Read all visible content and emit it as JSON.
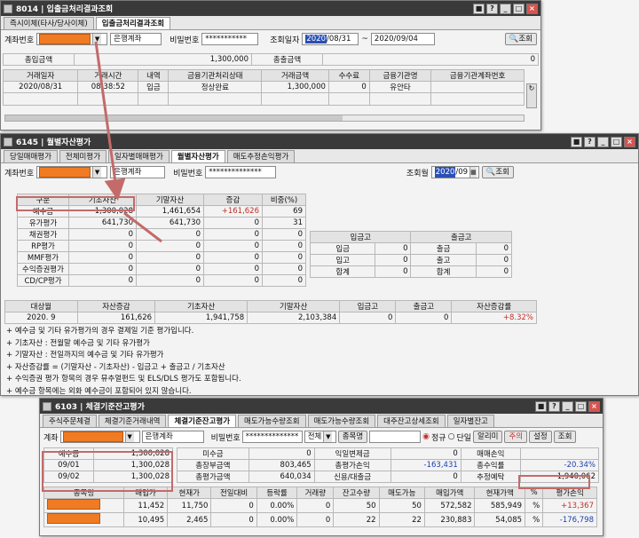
{
  "win1": {
    "title": "8014 | 입출금처리결과조회",
    "tabs": [
      "즉시이체(타사/당사이체)",
      "입출금처리결과조회"
    ],
    "account_label": "계좌번호",
    "account_name": "은행계좌",
    "password_label": "비밀번호",
    "password_value": "***********",
    "date_label": "조회일자",
    "date_from_sel": "2020",
    "date_from_rest": "/08/31",
    "date_sep": "~",
    "date_to": "2020/09/04",
    "search_label": "조회",
    "total_in_label": "총입금액",
    "total_in_value": "1,300,000",
    "total_out_label": "총출금액",
    "total_out_value": "0",
    "headers": [
      "거래일자",
      "거래시간",
      "내역",
      "금융기관처리상태",
      "거래금액",
      "수수료",
      "금융기관명",
      "금융기관계좌번호"
    ],
    "rows": [
      [
        "2020/08/31",
        "08:38:52",
        "입금",
        "정상완료",
        "1,300,000",
        "0",
        "유안타",
        ""
      ]
    ]
  },
  "win2": {
    "title": "6145 | 월별자산평가",
    "tabs": [
      "당일매매평가",
      "전체미평가",
      "일자별매매평가",
      "월별자산평가",
      "매도추정손익평가"
    ],
    "account_label": "계좌번호",
    "account_name": "은행계좌",
    "password_label": "비밀번호",
    "password_value": "**************",
    "month_label": "조회월",
    "month_sel": "2020",
    "month_rest": "/09",
    "search_label": "조회",
    "headers": [
      "구분",
      "기초자산",
      "기말자산",
      "증감",
      "비중(%)"
    ],
    "rows": [
      [
        "예수금",
        "1,300,028",
        "1,461,654",
        "+161,626",
        "69"
      ],
      [
        "유가평가",
        "641,730",
        "641,730",
        "0",
        "31"
      ],
      [
        "채권평가",
        "0",
        "0",
        "0",
        "0"
      ],
      [
        "RP평가",
        "0",
        "0",
        "0",
        "0"
      ],
      [
        "MMF평가",
        "0",
        "0",
        "0",
        "0"
      ],
      [
        "수익증권평가",
        "0",
        "0",
        "0",
        "0"
      ],
      [
        "CD/CP평가",
        "0",
        "0",
        "0",
        "0"
      ]
    ],
    "inout_headers": [
      "입금고",
      "출금고"
    ],
    "inout_rows": [
      [
        "입금",
        "0",
        "출금",
        "0"
      ],
      [
        "입고",
        "0",
        "출고",
        "0"
      ],
      [
        "합계",
        "0",
        "합계",
        "0"
      ]
    ],
    "summary_headers": [
      "대상월",
      "자산증감",
      "기초자산",
      "기말자산",
      "입금고",
      "출금고",
      "자산증감률"
    ],
    "summary_row": [
      "2020. 9",
      "161,626",
      "1,941,758",
      "2,103,384",
      "0",
      "0",
      "+8.32%"
    ],
    "notes": [
      "+ 예수금 및 기타 유가평가의 경우 결제일 기준 평가입니다.",
      "+ 기초자산 : 전월말 예수금 및 기타 유가평가",
      "+ 기말자산 : 전일까지의 예수금 및 기타 유가평가",
      "+ 자산증감률 = (기말자산 - 기초자산) - 입금고 + 출금고 / 기초자산",
      "+ 수익증권 평가 항목의 경우 뮤추얼펀드 및 ELS/DLS 평가도 포함됩니다.",
      "+ 예수금 항목에는 외화 예수금이 포함되어 있지 않습니다."
    ]
  },
  "win3": {
    "title": "6103 | 체결기준잔고평가",
    "tabs": [
      "주식주문체결",
      "체결기준거래내역",
      "체결기준잔고평가",
      "매도가능수량조회",
      "매도가능수량조회",
      "대주잔고상세조회",
      "일자별잔고"
    ],
    "account_label": "계좌",
    "account_name": "은행계좌",
    "password_label": "비밀번호",
    "password_value": "**************",
    "filter_value": "전체",
    "stock_btn": "종목명",
    "radio_1": "정규",
    "radio_2": "단일",
    "btns": [
      "알리미",
      "주의",
      "설정",
      "조회"
    ],
    "deposit_rows": [
      [
        "예수금",
        "1,300,028"
      ],
      [
        "09/01",
        "1,300,028"
      ],
      [
        "09/02",
        "1,300,028"
      ]
    ],
    "info_rows": [
      [
        "미수금",
        "0",
        "익일변제금",
        "0",
        "매매손익",
        ""
      ],
      [
        "총장부금액",
        "803,465",
        "총평가손익",
        "-163,431",
        "총수익률",
        "-20.34%"
      ],
      [
        "총평가금액",
        "640,034",
        "신용/대출금",
        "0",
        "추정예탁",
        "1,940,062"
      ]
    ],
    "headers": [
      "종목명",
      "매입가",
      "현재가",
      "전일대비",
      "등락률",
      "거래량",
      "잔고수량",
      "매도가능",
      "매입가액",
      "현재가액",
      "%",
      "평가손익"
    ],
    "rows": [
      [
        "",
        "11,452",
        "11,750",
        "0",
        "0.00%",
        "0",
        "50",
        "50",
        "572,582",
        "585,949",
        "%",
        "+13,367"
      ],
      [
        "",
        "10,495",
        "2,465",
        "0",
        "0.00%",
        "0",
        "22",
        "22",
        "230,883",
        "54,085",
        "%",
        "-176,798"
      ]
    ]
  }
}
